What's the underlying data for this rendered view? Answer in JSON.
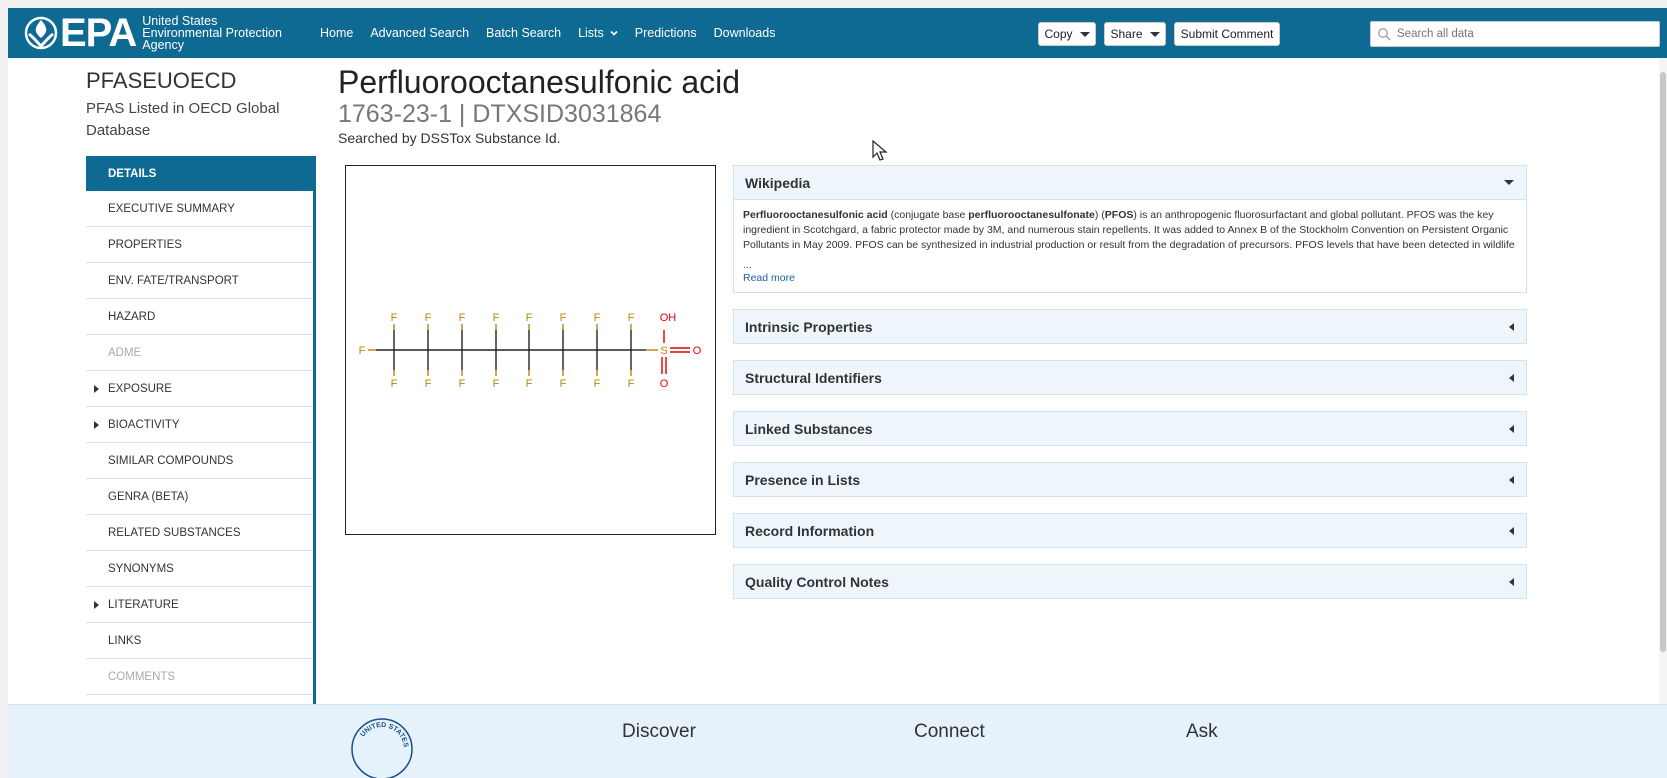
{
  "header": {
    "logo_text": "EPA",
    "agency_lines": [
      "United States",
      "Environmental Protection",
      "Agency"
    ],
    "nav": [
      {
        "label": "Home",
        "has_dropdown": false
      },
      {
        "label": "Advanced Search",
        "has_dropdown": false
      },
      {
        "label": "Batch Search",
        "has_dropdown": false
      },
      {
        "label": "Lists",
        "has_dropdown": true
      },
      {
        "label": "Predictions",
        "has_dropdown": false
      },
      {
        "label": "Downloads",
        "has_dropdown": false
      }
    ],
    "copy_label": "Copy",
    "share_label": "Share",
    "submit_label": "Submit Comment",
    "search_placeholder": "Search all data",
    "bar_color": "#0e6993"
  },
  "list": {
    "name": "PFASEUOECD",
    "description": "PFAS Listed in OECD Global Database"
  },
  "sidebar": {
    "items": [
      {
        "label": "DETAILS",
        "state": "active",
        "expandable": false
      },
      {
        "label": "EXECUTIVE SUMMARY",
        "state": "normal",
        "expandable": false
      },
      {
        "label": "PROPERTIES",
        "state": "normal",
        "expandable": false
      },
      {
        "label": "ENV. FATE/TRANSPORT",
        "state": "normal",
        "expandable": false
      },
      {
        "label": "HAZARD",
        "state": "normal",
        "expandable": false
      },
      {
        "label": "ADME",
        "state": "disabled",
        "expandable": false
      },
      {
        "label": "EXPOSURE",
        "state": "normal",
        "expandable": true
      },
      {
        "label": "BIOACTIVITY",
        "state": "normal",
        "expandable": true
      },
      {
        "label": "SIMILAR COMPOUNDS",
        "state": "normal",
        "expandable": false
      },
      {
        "label": "GENRA (BETA)",
        "state": "normal",
        "expandable": false
      },
      {
        "label": "RELATED SUBSTANCES",
        "state": "normal",
        "expandable": false
      },
      {
        "label": "SYNONYMS",
        "state": "normal",
        "expandable": false
      },
      {
        "label": "LITERATURE",
        "state": "normal",
        "expandable": true
      },
      {
        "label": "LINKS",
        "state": "normal",
        "expandable": false
      },
      {
        "label": "COMMENTS",
        "state": "disabled",
        "expandable": false
      }
    ]
  },
  "substance": {
    "name": "Perfluorooctanesulfonic acid",
    "ids": "1763-23-1 | DTXSID3031864",
    "searched_by": "Searched by DSSTox Substance Id."
  },
  "structure": {
    "atom_color_fluorine": "#b8860b",
    "atom_color_oxygen": "#e00000",
    "fluorine_label": "F",
    "sulfur_label": "S",
    "oxygen_label": "O",
    "hydroxyl_label": "OH"
  },
  "wikipedia": {
    "title": "Wikipedia",
    "expanded": true,
    "bold1": "Perfluorooctanesulfonic acid",
    "text1": " (conjugate base ",
    "bold2": "perfluorooctanesulfonate",
    "text2": ") (",
    "bold3": "PFOS",
    "text3": ") is an anthropogenic fluorosurfactant and global pollutant. PFOS was the key ingredient in Scotchgard, a fabric protector made by 3M, and numerous stain repellents. It was added to Annex B of the Stockholm Convention on Persistent Organic Pollutants in May 2009. PFOS can be synthesized in industrial production or result from the degradation of precursors. PFOS levels that have been detected in wildlife",
    "ellipsis": "...",
    "read_more": "Read more"
  },
  "panels": [
    {
      "title": "Intrinsic Properties"
    },
    {
      "title": "Structural Identifiers"
    },
    {
      "title": "Linked Substances"
    },
    {
      "title": "Presence in Lists"
    },
    {
      "title": "Record Information"
    },
    {
      "title": "Quality Control Notes"
    }
  ],
  "footer": {
    "seal_text": "UNITED STATES",
    "columns": [
      "Discover",
      "Connect",
      "Ask"
    ]
  }
}
